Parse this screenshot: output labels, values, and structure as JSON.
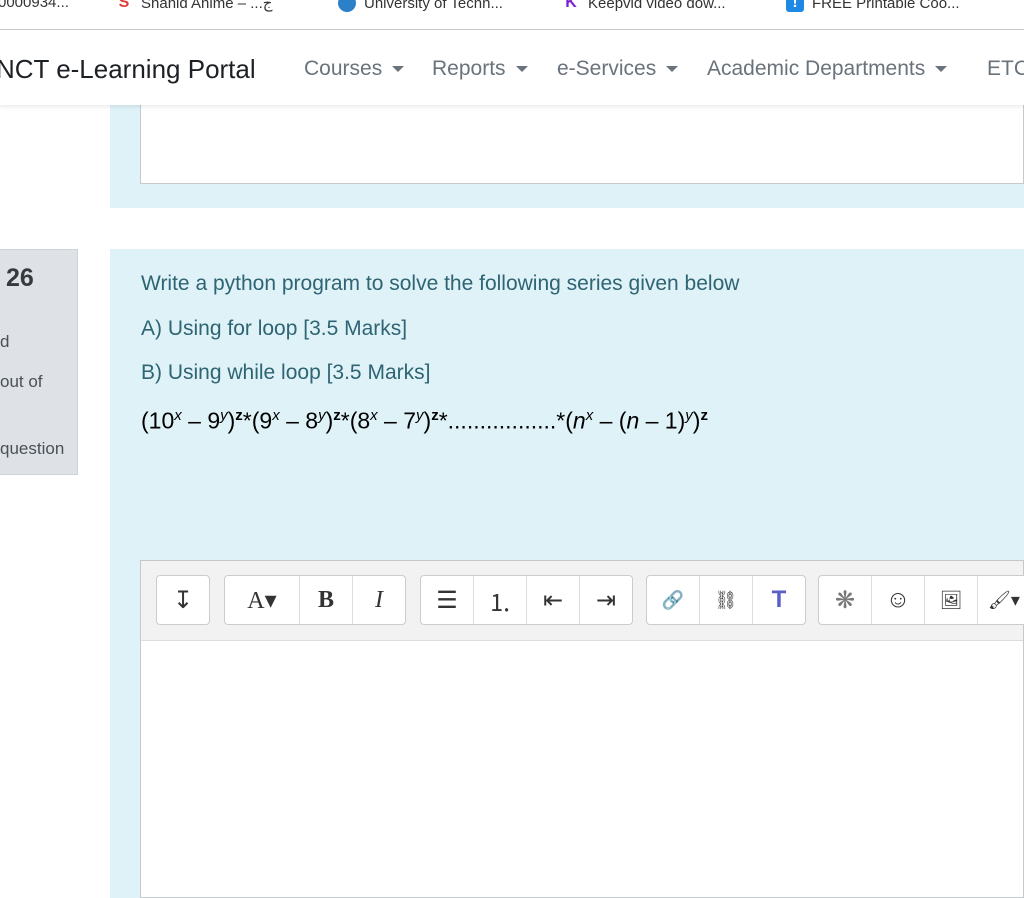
{
  "bookmarks": [
    {
      "label": "0000934..."
    },
    {
      "label": "Shahid Anime – ...ج"
    },
    {
      "label": "University of Techn..."
    },
    {
      "label": "Keepvid video dow..."
    },
    {
      "label": "FREE Printable Coo..."
    }
  ],
  "nav": {
    "brand": "NCT e-Learning Portal",
    "items": [
      "Courses",
      "Reports",
      "e-Services",
      "Academic Departments",
      "ETC"
    ]
  },
  "question_info": {
    "number": "26",
    "line1": "d",
    "line2": "out of",
    "line3": "question"
  },
  "question": {
    "line1": "Write a python program to solve the following series given below",
    "line2": "A) Using for loop [3.5 Marks]",
    "line3": "B) Using while loop [3.5 Marks]",
    "equation": {
      "t1": "(10",
      "e1": "x",
      "t2": " – 9",
      "e2": "y",
      "t3": ")",
      "e3": "z",
      "t4": "*(9",
      "e4": "x",
      "t5": " – 8",
      "e5": "y",
      "t6": ")",
      "e6": "z",
      "t7": "*(8",
      "e7": "x",
      "t8": " – 7",
      "e8": "y",
      "t9": ")",
      "e9": "z",
      "t10": "*.................*(",
      "t11": "n",
      "e11": "x",
      "t12": " – (",
      "t13": "n",
      "t14": " – 1)",
      "e14": "y",
      "t15": ")",
      "e15": "z"
    }
  },
  "toolbar": {
    "icons": [
      "expand-arrow",
      "font-color",
      "bold",
      "italic",
      "bullet-list",
      "numbered-list",
      "outdent",
      "indent",
      "link",
      "unlink",
      "teams",
      "accessibility",
      "emoji",
      "image",
      "paintbrush"
    ],
    "glyphs": [
      "↧",
      "A▾",
      "B",
      "I",
      "☰",
      "⒈",
      "⇤",
      "⇥",
      "🔗",
      "⛓",
      "T",
      "❋",
      "☺",
      "🖼",
      "🖌▾"
    ]
  }
}
